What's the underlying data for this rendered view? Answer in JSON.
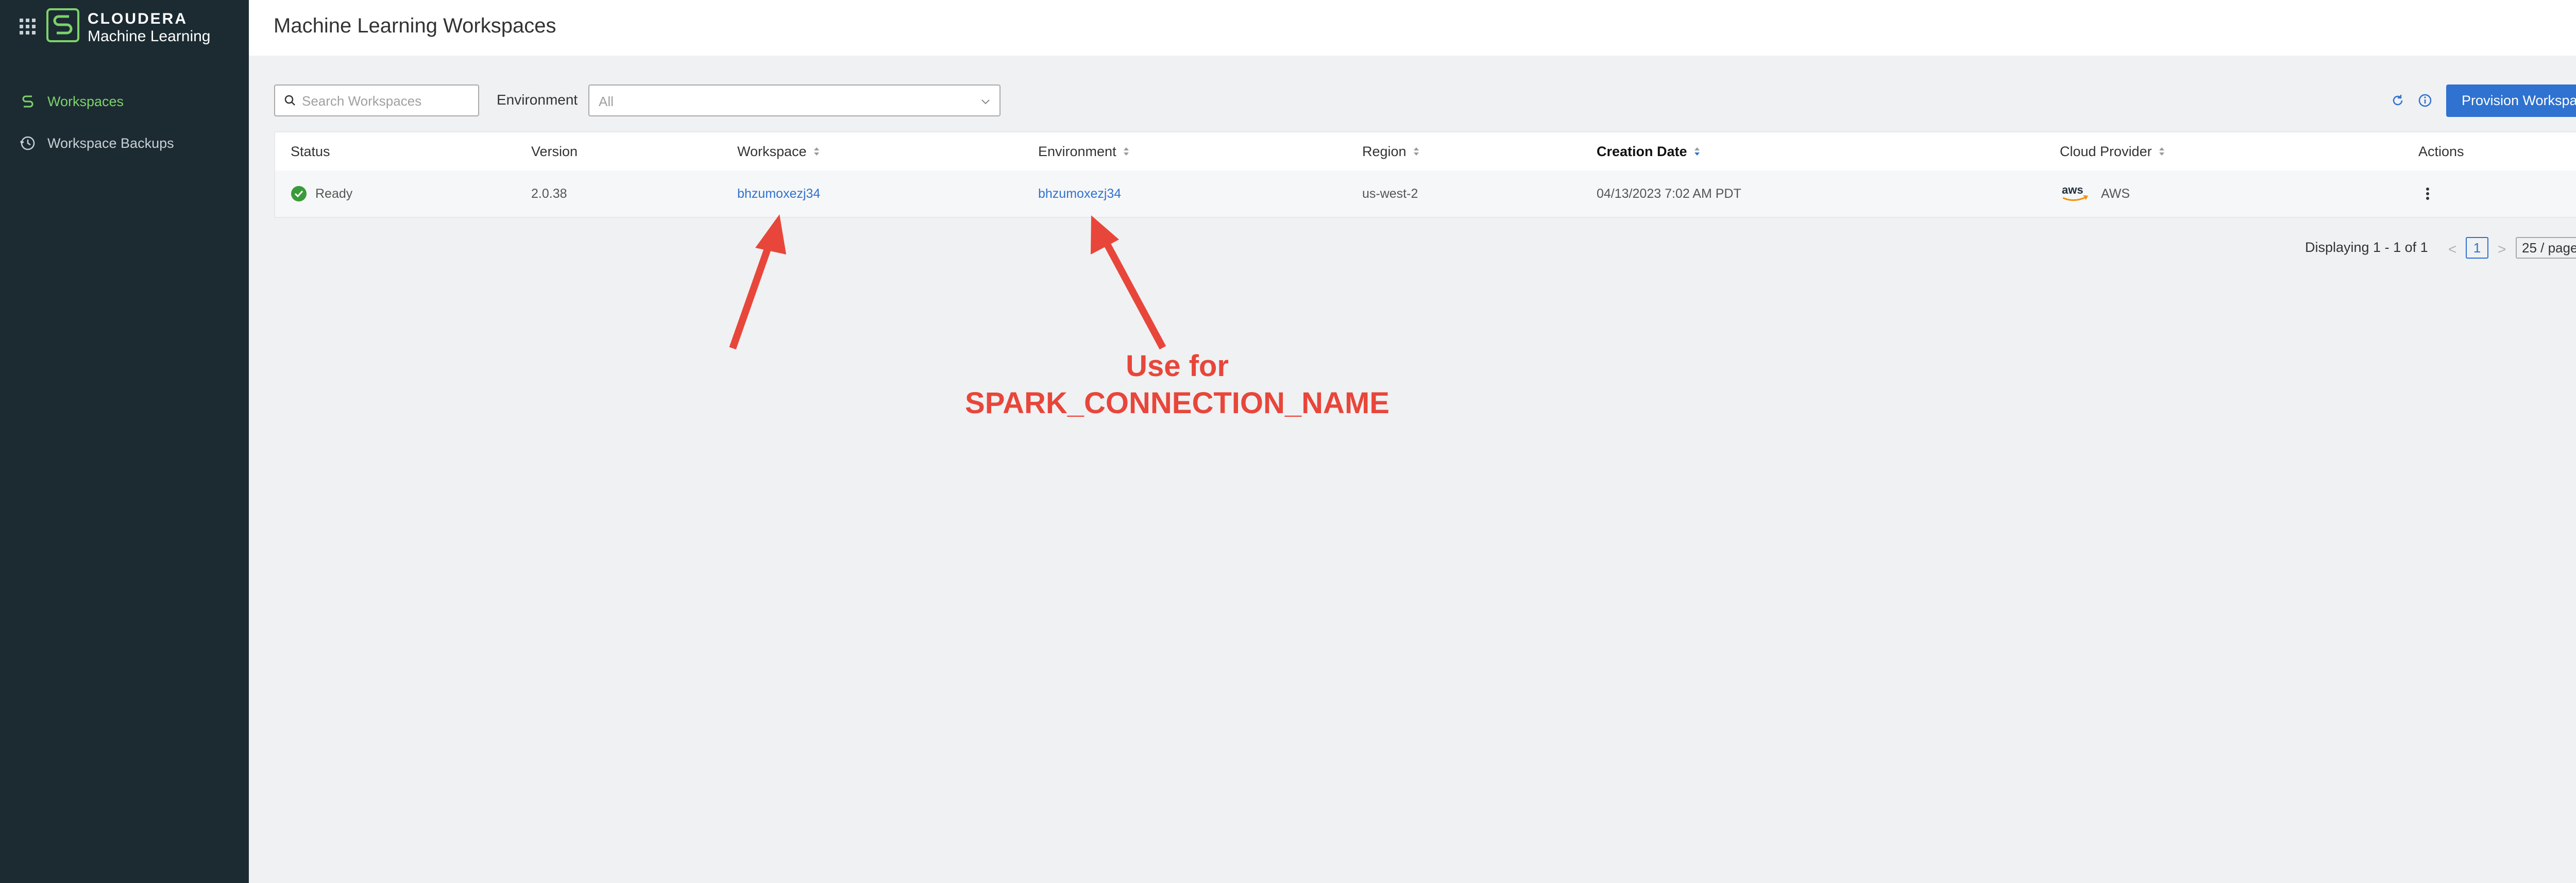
{
  "app": {
    "brand_line1": "CLOUDERA",
    "brand_line2": "Machine Learning"
  },
  "sidebar": {
    "items": [
      {
        "label": "Workspaces",
        "active": true
      },
      {
        "label": "Workspace Backups",
        "active": false
      }
    ]
  },
  "header": {
    "title": "Machine Learning Workspaces"
  },
  "toolbar": {
    "search_placeholder": "Search Workspaces",
    "env_label": "Environment",
    "env_value": "All",
    "provision_label": "Provision Workspace"
  },
  "table": {
    "headers": [
      "Status",
      "Version",
      "Workspace",
      "Environment",
      "Region",
      "Creation Date",
      "Cloud Provider",
      "Actions"
    ],
    "rows": [
      {
        "status": "Ready",
        "version": "2.0.38",
        "workspace": "bhzumoxezj34",
        "environment": "bhzumoxezj34",
        "region": "us-west-2",
        "creation_date": "04/13/2023 7:02 AM PDT",
        "cloud_provider": "AWS",
        "aws_logo": "aws"
      }
    ]
  },
  "pagination": {
    "summary": "Displaying 1 - 1 of 1",
    "page": "1",
    "page_size": "25 / page"
  },
  "annotation": {
    "line1": "Use for",
    "line2": "SPARK_CONNECTION_NAME"
  },
  "colors": {
    "sidebar_bg": "#1c2b32",
    "accent_green": "#7dd36a",
    "primary_blue": "#2f72d0",
    "annotation_red": "#e8463a"
  }
}
